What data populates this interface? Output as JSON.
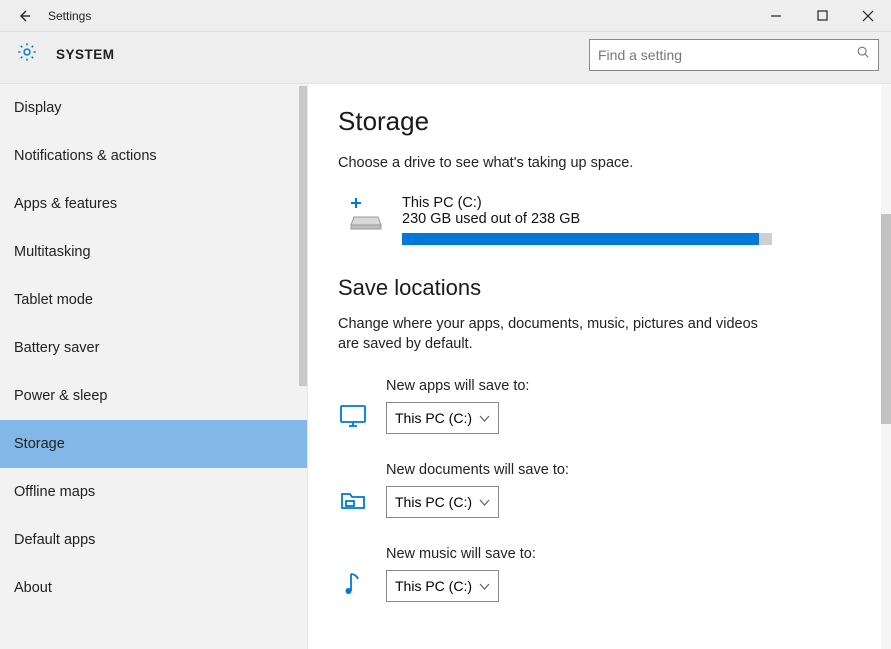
{
  "window": {
    "title": "Settings"
  },
  "header": {
    "section": "SYSTEM"
  },
  "search": {
    "placeholder": "Find a setting"
  },
  "sidebar": {
    "items": [
      {
        "label": "Display",
        "selected": false
      },
      {
        "label": "Notifications & actions",
        "selected": false
      },
      {
        "label": "Apps & features",
        "selected": false
      },
      {
        "label": "Multitasking",
        "selected": false
      },
      {
        "label": "Tablet mode",
        "selected": false
      },
      {
        "label": "Battery saver",
        "selected": false
      },
      {
        "label": "Power & sleep",
        "selected": false
      },
      {
        "label": "Storage",
        "selected": true
      },
      {
        "label": "Offline maps",
        "selected": false
      },
      {
        "label": "Default apps",
        "selected": false
      },
      {
        "label": "About",
        "selected": false
      }
    ]
  },
  "page": {
    "title": "Storage",
    "description": "Choose a drive to see what's taking up space.",
    "drive": {
      "name": "This PC (C:)",
      "usage_text": "230 GB used out of 238 GB",
      "used_gb": 230,
      "total_gb": 238,
      "fill_percent": 96.6
    },
    "save_locations": {
      "title": "Save locations",
      "description": "Change where your apps, documents, music, pictures and videos are saved by default.",
      "rows": [
        {
          "icon": "monitor-icon",
          "label": "New apps will save to:",
          "value": "This PC (C:)"
        },
        {
          "icon": "folder-icon",
          "label": "New documents will save to:",
          "value": "This PC (C:)"
        },
        {
          "icon": "music-icon",
          "label": "New music will save to:",
          "value": "This PC (C:)"
        }
      ]
    }
  }
}
